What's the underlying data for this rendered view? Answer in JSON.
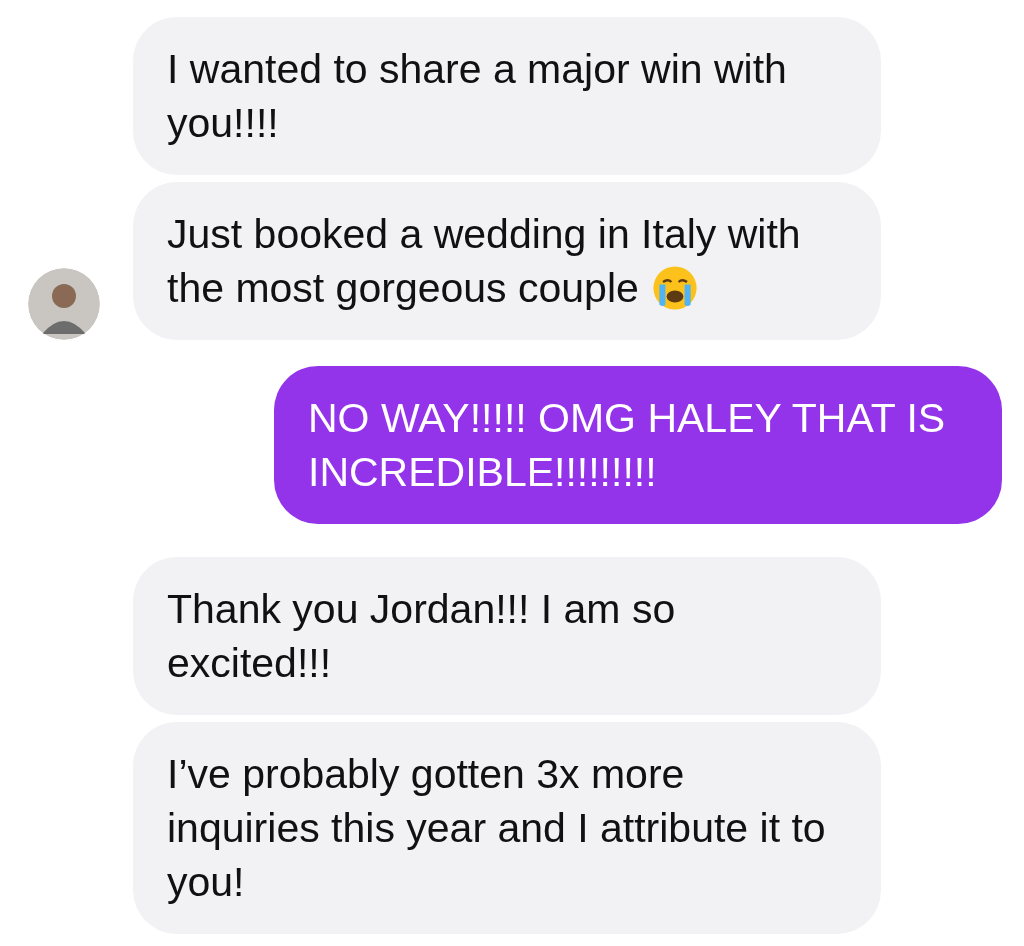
{
  "messages": [
    {
      "kind": "received",
      "text": "I wanted to share a major win with you!!!!",
      "avatar": false,
      "trailing_icon": false
    },
    {
      "kind": "received",
      "text": "Just booked a wedding in Italy with the most gorgeous couple",
      "avatar": true,
      "trailing_icon": true
    },
    {
      "kind": "sent",
      "text": "NO WAY!!!!! OMG HALEY THAT IS INCREDIBLE!!!!!!!!!",
      "avatar": false,
      "trailing_icon": false
    },
    {
      "kind": "received",
      "text": "Thank you Jordan!!! I am so excited!!!",
      "avatar": false,
      "trailing_icon": false
    },
    {
      "kind": "received",
      "text": "I’ve probably gotten 3x more inquiries this year and I attribute it to you!",
      "avatar": false,
      "trailing_icon": false
    }
  ]
}
